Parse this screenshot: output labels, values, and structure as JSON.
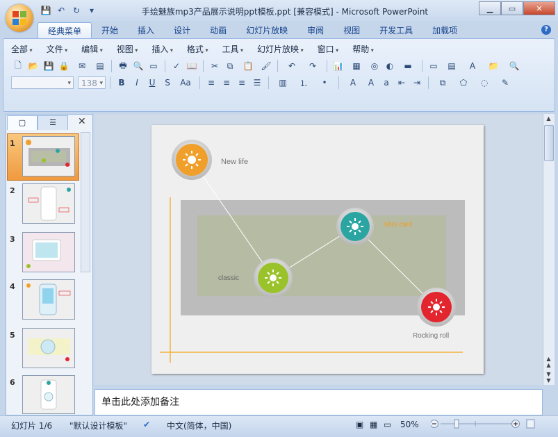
{
  "window": {
    "title": "手绘魅族mp3产品展示说明ppt模板.ppt [兼容模式] - Microsoft PowerPoint"
  },
  "tabs": [
    "经典菜单",
    "开始",
    "插入",
    "设计",
    "动画",
    "幻灯片放映",
    "审阅",
    "视图",
    "开发工具",
    "加载项"
  ],
  "menu": [
    "全部",
    "文件",
    "编辑",
    "视图",
    "插入",
    "格式",
    "工具",
    "幻灯片放映",
    "窗口",
    "帮助"
  ],
  "font_size_value": "138",
  "notes_placeholder": "单击此处添加备注",
  "slide_numbers": [
    "1",
    "2",
    "3",
    "4",
    "5",
    "6"
  ],
  "slide": {
    "labels": {
      "new_life": "New life",
      "mini_card": "Mini card",
      "classic": "classic",
      "rocking_roll": "Rocking roll"
    },
    "colors": {
      "orange": "#f0a02a",
      "teal": "#2aa5a2",
      "green": "#9ac22a",
      "red": "#e3262e"
    }
  },
  "status": {
    "slide_info": "幻灯片 1/6",
    "theme": "\"默认设计模板\"",
    "language": "中文(简体，中国)",
    "zoom": "50%"
  }
}
